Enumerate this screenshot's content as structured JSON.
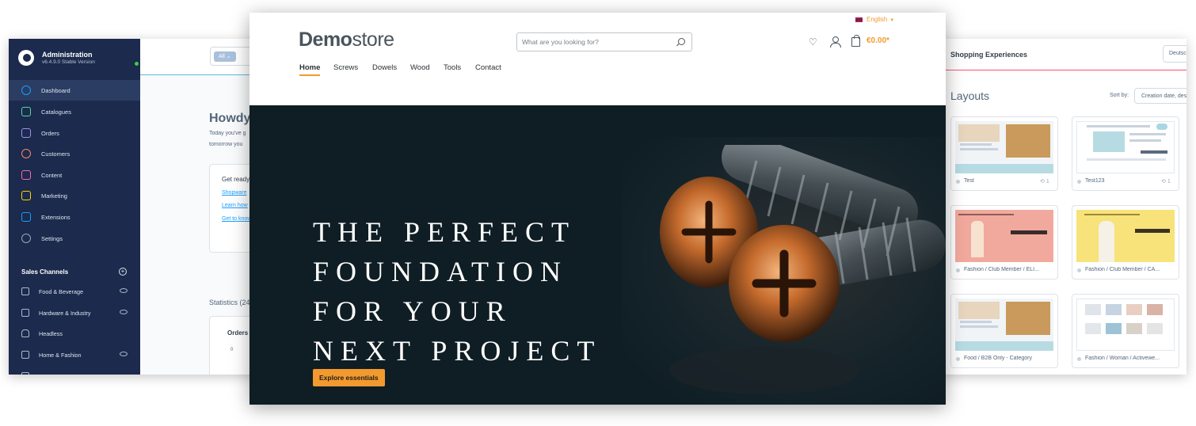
{
  "admin": {
    "brand": {
      "title": "Administration",
      "version": "v6.4.9.0 Stable Version"
    },
    "nav": [
      {
        "label": "Dashboard",
        "icon": "dashboard-icon",
        "color": "#189eff"
      },
      {
        "label": "Catalogues",
        "icon": "catalogue-icon",
        "color": "#57d9a3"
      },
      {
        "label": "Orders",
        "icon": "orders-icon",
        "color": "#a092f0"
      },
      {
        "label": "Customers",
        "icon": "customers-icon",
        "color": "#f88962"
      },
      {
        "label": "Content",
        "icon": "content-icon",
        "color": "#ff68b4"
      },
      {
        "label": "Marketing",
        "icon": "marketing-icon",
        "color": "#ffd700"
      },
      {
        "label": "Extensions",
        "icon": "extensions-icon",
        "color": "#189eff"
      },
      {
        "label": "Settings",
        "icon": "settings-icon",
        "color": "#9aa8b5"
      }
    ],
    "sales_channels": {
      "heading": "Sales Channels",
      "items": [
        {
          "label": "Food & Beverage"
        },
        {
          "label": "Hardware & Industry"
        },
        {
          "label": "Headless"
        },
        {
          "label": "Home & Fashion"
        }
      ]
    },
    "search": {
      "filter_label": "All"
    },
    "greeting": "Howdy",
    "greeting_lines": [
      "Today you've g",
      "tomorrow you"
    ],
    "getready": {
      "title": "Get ready",
      "links": [
        "Shopware",
        "Learn how",
        "Get to know"
      ]
    },
    "statistics": {
      "label": "Statistics (24",
      "card_title": "Orders",
      "zero": "0"
    }
  },
  "cms": {
    "header_title": "Shopping Experiences",
    "language": "Deutsch",
    "section_title": "Layouts",
    "sort_label": "Sort by:",
    "sort_value": "Creation date, descending",
    "layouts": [
      {
        "name": "Test",
        "count": "1",
        "thumb": "image-text"
      },
      {
        "name": "Test123",
        "count": "1",
        "thumb": "gallery"
      },
      {
        "name": "Fashion / Club Member / ELI...",
        "count": "",
        "thumb": "fashion-pink"
      },
      {
        "name": "Fashion / Club Member / CA...",
        "count": "",
        "thumb": "fashion-yellow"
      },
      {
        "name": "Food / B2B Only - Category",
        "count": "",
        "thumb": "image-text"
      },
      {
        "name": "Fashion / Woman / Activewe...",
        "count": "",
        "thumb": "product-grid"
      }
    ]
  },
  "store": {
    "language": "English",
    "logo": {
      "bold": "Demo",
      "light": "store"
    },
    "search_placeholder": "What are you looking for?",
    "cart_total": "€0.00*",
    "nav": [
      "Home",
      "Screws",
      "Dowels",
      "Wood",
      "Tools",
      "Contact"
    ],
    "hero": {
      "title_lines": [
        "THE PERFECT",
        "FOUNDATION",
        "FOR YOUR",
        "NEXT PROJECT"
      ],
      "button": "Explore essentials"
    }
  },
  "colors": {
    "accent_orange": "#f29a2e",
    "admin_sidebar": "#1b2a4d",
    "cms_accent": "#ff4f76",
    "hero_background": "#0f1e24"
  }
}
